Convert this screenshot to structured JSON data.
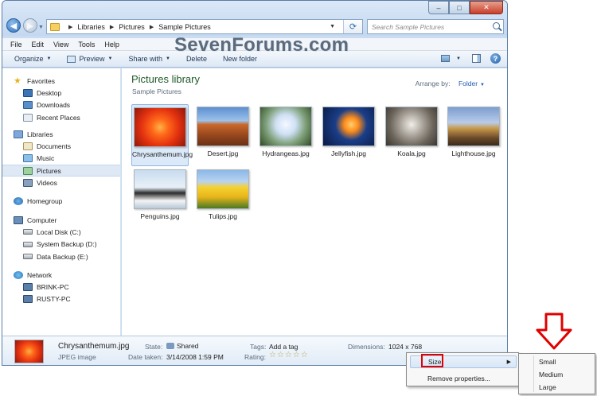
{
  "watermark": "SevenForums.com",
  "address": {
    "crumbs": [
      "Libraries",
      "Pictures",
      "Sample Pictures"
    ]
  },
  "search": {
    "placeholder": "Search Sample Pictures"
  },
  "window_controls": {
    "minimize": "–",
    "maximize": "□",
    "close": "✕"
  },
  "menubar": [
    "File",
    "Edit",
    "View",
    "Tools",
    "Help"
  ],
  "toolbar": {
    "organize": "Organize",
    "preview": "Preview",
    "share": "Share with",
    "delete": "Delete",
    "new_folder": "New folder"
  },
  "nav": {
    "favorites": {
      "header": "Favorites",
      "items": [
        "Desktop",
        "Downloads",
        "Recent Places"
      ]
    },
    "libraries": {
      "header": "Libraries",
      "items": [
        "Documents",
        "Music",
        "Pictures",
        "Videos"
      ]
    },
    "homegroup": "Homegroup",
    "computer": {
      "header": "Computer",
      "items": [
        "Local Disk (C:)",
        "System Backup (D:)",
        "Data Backup (E:)"
      ]
    },
    "network": {
      "header": "Network",
      "items": [
        "BRINK-PC",
        "RUSTY-PC"
      ]
    }
  },
  "library": {
    "title": "Pictures library",
    "subtitle": "Sample Pictures",
    "arrange_label": "Arrange by:",
    "arrange_value": "Folder"
  },
  "files": [
    {
      "name": "Chrysanthemum.jpg",
      "selected": true
    },
    {
      "name": "Desert.jpg"
    },
    {
      "name": "Hydrangeas.jpg"
    },
    {
      "name": "Jellyfish.jpg"
    },
    {
      "name": "Koala.jpg"
    },
    {
      "name": "Lighthouse.jpg"
    },
    {
      "name": "Penguins.jpg"
    },
    {
      "name": "Tulips.jpg"
    }
  ],
  "details": {
    "name": "Chrysanthemum.jpg",
    "type": "JPEG image",
    "state_label": "State:",
    "state_value": "Shared",
    "date_label": "Date taken:",
    "date_value": "3/14/2008 1:59 PM",
    "tags_label": "Tags:",
    "tags_value": "Add a tag",
    "rating_label": "Rating:",
    "rating_stars": "☆☆☆☆☆",
    "dimensions_label": "Dimensions:",
    "dimensions_value": "1024 x 768"
  },
  "context_menu": {
    "size": "Size",
    "remove": "Remove properties..."
  },
  "submenu": [
    "Small",
    "Medium",
    "Large"
  ]
}
